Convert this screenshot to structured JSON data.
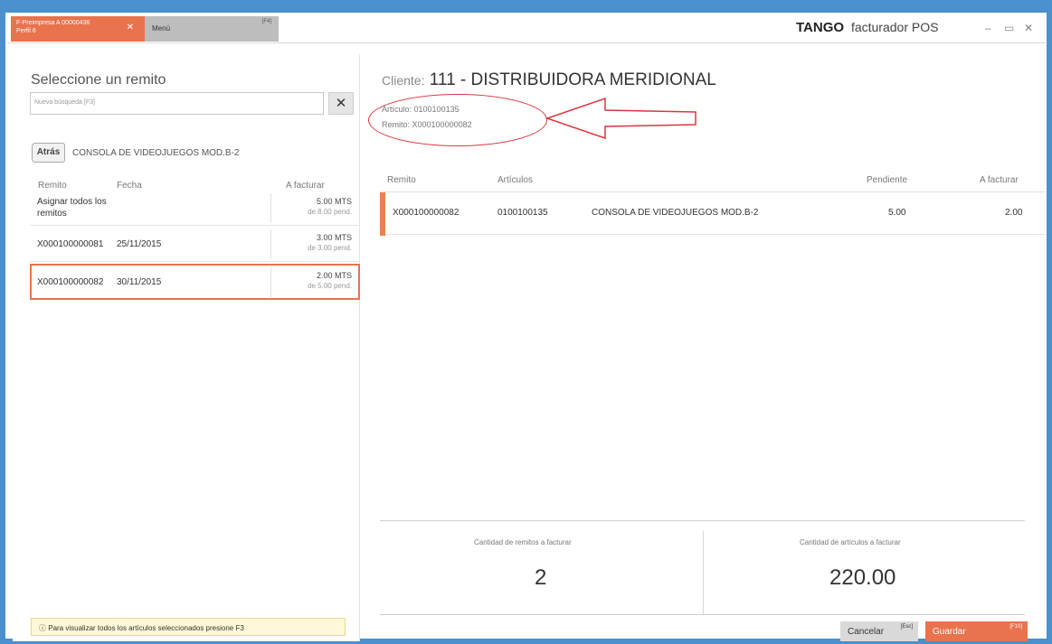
{
  "window": {
    "tab_active_line1": "F-Preimpresa A 00000436",
    "tab_active_line2": "Perfil 6",
    "tab_close": "✕",
    "tab_menu": "Menú",
    "tab_menu_hotkey": "[F4]",
    "brand_logo": "TANGO",
    "brand_product": "facturador POS",
    "minimize": "–",
    "maximize": "▭",
    "close": "✕"
  },
  "left": {
    "title": "Seleccione un remito",
    "search_placeholder": "Nueva búsqueda [F3]",
    "search_clear": "✕",
    "back": "Atrás",
    "breadcrumb": "CONSOLA DE VIDEOJUEGOS MOD.B-2",
    "columns": [
      "Remito",
      "Fecha",
      "A facturar"
    ],
    "rows": [
      {
        "remito": "Asignar todos los remitos",
        "fecha": "",
        "amount": "5.00 MTS",
        "pending": "de 8.00 pend."
      },
      {
        "remito": "X000100000081",
        "fecha": "25/11/2015",
        "amount": "3.00 MTS",
        "pending": "de 3.00 pend."
      },
      {
        "remito": "X000100000082",
        "fecha": "30/11/2015",
        "amount": "2.00 MTS",
        "pending": "de 5.00 pend."
      }
    ],
    "hint_icon": "ⓘ",
    "hint": "Para visualizar todos los artículos seleccionados presione F3"
  },
  "right": {
    "client_label": "Cliente:",
    "client_code": "111",
    "client_sep": "-",
    "client_name": "DISTRIBUIDORA MERIDIONAL",
    "articulo_label": "Artículo:",
    "articulo_value": "0100100135",
    "remito_label": "Remito:",
    "remito_value": "X000100000082",
    "columns": [
      "Remito",
      "Artículos",
      "Pendiente",
      "A facturar"
    ],
    "row": {
      "remito": "X000100000082",
      "articulo": "0100100135",
      "descripcion": "CONSOLA DE VIDEOJUEGOS MOD.B-2",
      "pendiente": "5.00",
      "a_facturar": "2.00"
    },
    "summary": {
      "remitos_label": "Cantidad de remitos a facturar",
      "remitos_value": "2",
      "articulos_label": "Cantidad de artículos a facturar",
      "articulos_value": "220.00"
    },
    "buttons": {
      "cancel": "Cancelar",
      "cancel_hotkey": "[Esc]",
      "save": "Guardar",
      "save_hotkey": "[F10]"
    }
  },
  "colors": {
    "accent": "#e8734d",
    "annotation": "#d9363e",
    "window_border": "#4a90cc"
  }
}
